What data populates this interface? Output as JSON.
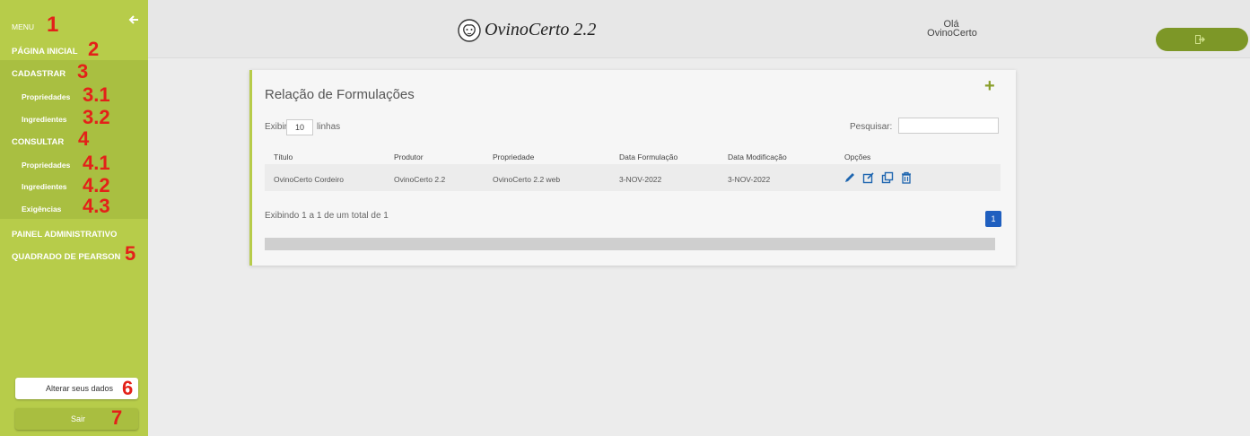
{
  "sidebar": {
    "menu_label": "MENU",
    "items": [
      {
        "label": "PÁGINA INICIAL",
        "mark": "2"
      },
      {
        "label": "CADASTRAR",
        "mark": "3"
      },
      {
        "label": "Propriedades",
        "mark": "3.1"
      },
      {
        "label": "Ingredientes",
        "mark": "3.2"
      },
      {
        "label": "CONSULTAR",
        "mark": "4"
      },
      {
        "label": "Propriedades",
        "mark": "4.1"
      },
      {
        "label": "Ingredientes",
        "mark": "4.2"
      },
      {
        "label": "Exigências",
        "mark": "4.3"
      },
      {
        "label": "PAINEL ADMINISTRATIVO",
        "mark": ""
      },
      {
        "label": "QUADRADO DE PEARSON",
        "mark": "5"
      }
    ],
    "menu_mark": "1",
    "edit_button_label": "Alterar seus dados",
    "edit_button_mark": "6",
    "logout_button_label": "Sair",
    "logout_button_mark": "7"
  },
  "header": {
    "app_title": "OvinoCerto 2.2",
    "greeting": "Olá",
    "username": "OvinoCerto"
  },
  "card": {
    "title": "Relação de Formulações",
    "show_prefix": "Exibir",
    "show_value": "10",
    "show_suffix": "linhas",
    "search_label": "Pesquisar:",
    "search_value": "",
    "columns": [
      "Título",
      "Produtor",
      "Propriedade",
      "Data Formulação",
      "Data Modificação",
      "Opções"
    ],
    "rows": [
      [
        "OvinoCerto Cordeiro",
        "OvinoCerto 2.2",
        "OvinoCerto 2.2 web",
        "3-NOV-2022",
        "3-NOV-2022"
      ]
    ],
    "row_icons": [
      "pencil-icon",
      "edit-square-icon",
      "copy-icon",
      "trash-icon"
    ],
    "footer_info": "Exibindo 1 a 1 de um total de 1",
    "page_number": "1"
  },
  "colors": {
    "sidebar_bg": "#b7cc4a",
    "accent": "#8a9f2b",
    "annotation_red": "#e32119",
    "icon_blue": "#1f66b0",
    "page_button": "#1f5fbf"
  }
}
